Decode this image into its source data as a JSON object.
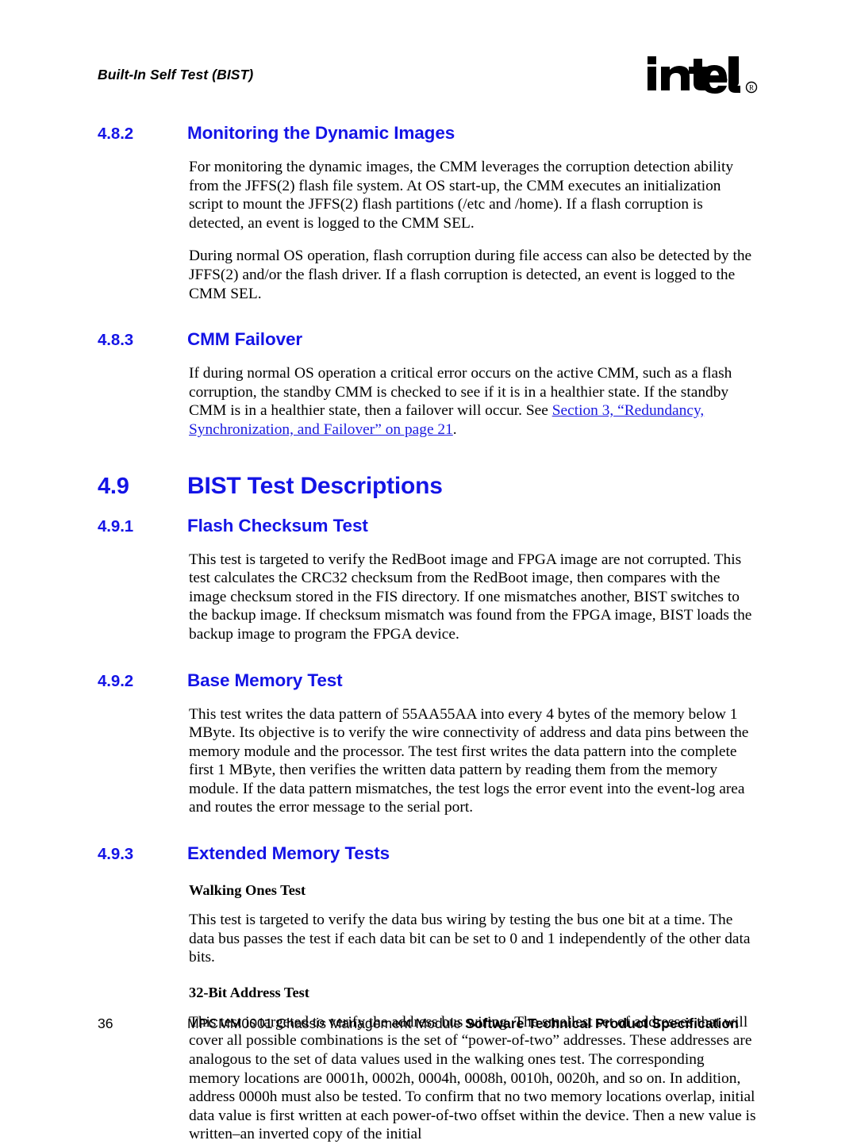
{
  "header": {
    "running_title": "Built-In Self Test (BIST)",
    "logo_name": "intel-logo",
    "logo_text": "intel",
    "logo_registered": "®"
  },
  "sections": {
    "s482": {
      "number": "4.8.2",
      "title": "Monitoring the Dynamic Images",
      "p1": "For monitoring the dynamic images, the CMM leverages the corruption detection ability from the JFFS(2) flash file system. At OS start-up, the CMM executes an initialization script to mount the JFFS(2) flash partitions (/etc and /home). If a flash corruption is detected, an event is logged to the CMM SEL.",
      "p2": "During normal OS operation, flash corruption during file access can also be detected by the JFFS(2) and/or the flash driver. If a flash corruption is detected, an event is logged to the CMM SEL."
    },
    "s483": {
      "number": "4.8.3",
      "title": "CMM Failover",
      "p1_before": "If during normal OS operation a critical error occurs on the active CMM, such as a flash corruption, the standby CMM is checked to see if it is in a healthier state. If the standby CMM is in a healthier state, then a failover will occur. See ",
      "p1_xref": "Section 3, “Redundancy, Synchronization, and Failover” on page 21",
      "p1_after": "."
    },
    "s49": {
      "number": "4.9",
      "title": "BIST Test Descriptions"
    },
    "s491": {
      "number": "4.9.1",
      "title": "Flash Checksum Test",
      "p1": "This test is targeted to verify the RedBoot image and FPGA image are not corrupted. This test calculates the CRC32 checksum from the RedBoot image, then compares with the image checksum stored in the FIS directory. If one mismatches another, BIST switches to the backup image. If checksum mismatch was found from the FPGA image, BIST loads the backup image to program the FPGA device."
    },
    "s492": {
      "number": "4.9.2",
      "title": "Base Memory Test",
      "p1": "This test writes the data pattern of 55AA55AA into every 4 bytes of the memory below 1 MByte. Its objective is to verify the wire connectivity of address and data pins between the memory module and the processor. The test first writes the data pattern into the complete first 1 MByte, then verifies the written data pattern by reading them from the memory module. If the data pattern mismatches, the test logs the error event into the event-log area and routes the error message to the serial port."
    },
    "s493": {
      "number": "4.9.3",
      "title": "Extended Memory Tests",
      "sub1_title": "Walking Ones Test",
      "sub1_p1": "This test is targeted to verify the data bus wiring by testing the bus one bit at a time. The data bus passes the test if each data bit can be set to 0 and 1 independently of the other data bits.",
      "sub2_title": "32-Bit Address Test",
      "sub2_p1": "This test is targeted to verify the address bus wiring. The smallest set of addresses that will cover all possible combinations is the set of “power-of-two” addresses. These addresses are analogous to the set of data values used in the walking ones test. The corresponding memory locations are 0001h, 0002h, 0004h, 0008h, 0010h, 0020h, and so on. In addition, address 0000h must also be tested. To confirm that no two memory locations overlap, initial data value is first written at each power-of-two offset within the device. Then a new value is written–an inverted copy of the initial"
    }
  },
  "footer": {
    "page_number": "36",
    "doc_title_regular": "MPCMM0001 Chassis Management Module ",
    "doc_title_bold": "Software Technical Product Specification"
  },
  "colors": {
    "heading_blue": "#1414e6",
    "xref_blue": "#1a1ae0",
    "text_black": "#000000",
    "background": "#ffffff"
  }
}
